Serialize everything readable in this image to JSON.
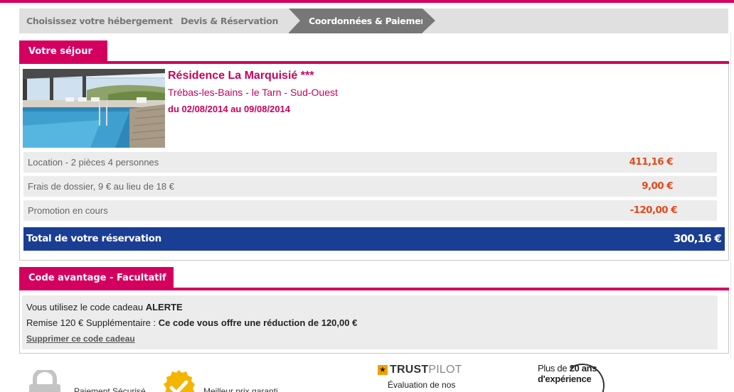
{
  "steps": {
    "step1": "Choisissez votre hébergement",
    "step2": "Devis & Réservation",
    "step3": "Coordonnées & Paiement"
  },
  "sejour": {
    "title": "Votre séjour",
    "residence_name": "Résidence La Marquisié ***",
    "location": "Trébas-les-Bains - le Tarn - Sud-Ouest",
    "dates": "du 02/08/2014 au 09/08/2014",
    "rows": [
      {
        "label": "Location - 2 pièces 4 personnes",
        "value": "411,16 €"
      },
      {
        "label": "Frais de dossier, 9 € au lieu de 18 €",
        "value": "9,00 €"
      },
      {
        "label": "Promotion en cours",
        "value": "-120,00 €"
      }
    ],
    "total_label": "Total de votre réservation",
    "total_value": "300,16 €"
  },
  "code": {
    "title": "Code avantage - Facultatif",
    "line1_prefix": "Vous utilisez le code cadeau",
    "line1_code": "ALERTE",
    "line2_prefix": "Remise 120 € Supplémentaire :",
    "line2_bold": "Ce code vous offre une réduction de 120,00 €",
    "remove_link": "Supprimer ce code cadeau"
  },
  "footer": {
    "secure": "Paiement Sécurisé",
    "best_price": "Meilleur prix garanti",
    "trustpilot_1": "TRUST",
    "trustpilot_2": "PILOT",
    "trustpilot_sub1": "Évaluation de nos",
    "experience_1a": "Plus de",
    "experience_1b": "20 ans",
    "experience_2": "d'expérience"
  },
  "colors": {
    "brand_pink": "#d4005f",
    "total_blue": "#1a3e94",
    "price_orange": "#e04a1e"
  }
}
